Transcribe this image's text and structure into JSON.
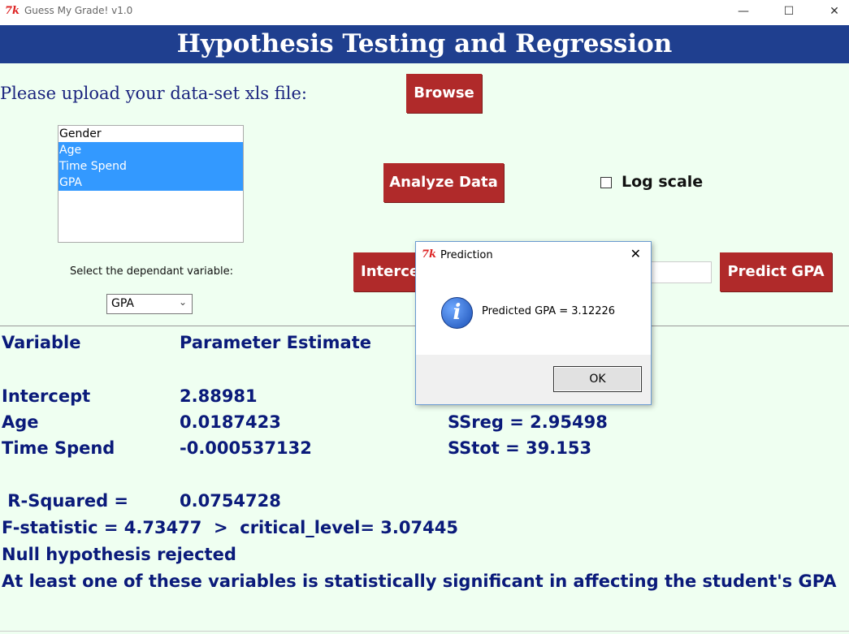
{
  "window": {
    "logo": "7k",
    "title": "Guess My Grade! v1.0",
    "minimize": "—",
    "maximize": "☐",
    "close": "✕"
  },
  "banner": {
    "title": "Hypothesis Testing and Regression"
  },
  "upload": {
    "label": "Please upload your data-set xls file:",
    "browse": "Browse"
  },
  "variables": {
    "items": [
      {
        "label": "Gender",
        "selected": false
      },
      {
        "label": "Age",
        "selected": true
      },
      {
        "label": "Time Spend",
        "selected": true
      },
      {
        "label": "GPA",
        "selected": true
      }
    ]
  },
  "analyze_button": "Analyze Data",
  "log_scale": {
    "label": "Log scale",
    "checked": false
  },
  "dependent": {
    "label": "Select the dependant variable:",
    "value": "GPA"
  },
  "intercept_button": "Intercept",
  "predict_button": "Predict GPA",
  "results": {
    "header_variable": "Variable",
    "header_estimate": "Parameter Estimate",
    "rows": [
      {
        "variable": "Intercept",
        "estimate": "2.88981",
        "stat": ""
      },
      {
        "variable": "Age",
        "estimate": "0.0187423",
        "stat": "SSreg = 2.95498"
      },
      {
        "variable": "Time Spend",
        "estimate": "-0.000537132",
        "stat": "SStot = 39.153"
      }
    ],
    "r_squared_label": " R-Squared =",
    "r_squared_value": "0.0754728",
    "f_statistic": "F-statistic = 4.73477  >  critical_level= 3.07445",
    "null_hypothesis": "Null hypothesis rejected",
    "conclusion": "At least one of these variables is statistically significant in affecting the student's GPA"
  },
  "dialog": {
    "title": "Prediction",
    "message": "Predicted GPA = 3.12226",
    "ok": "OK",
    "close": "✕",
    "icon": "i"
  }
}
